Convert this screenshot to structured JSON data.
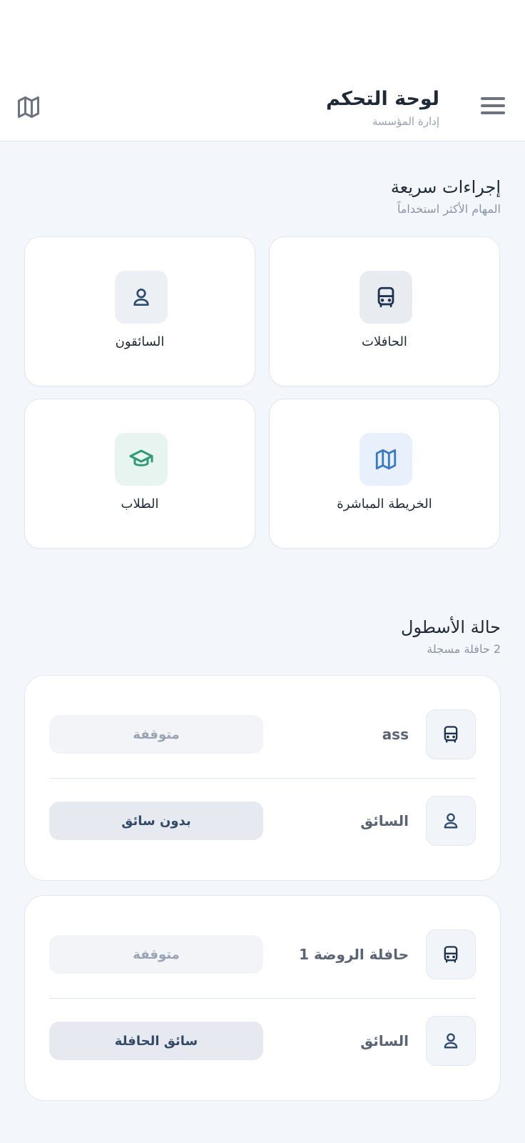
{
  "header": {
    "title": "لوحة التحكم",
    "subtitle": "إدارة المؤسسة",
    "menu_icon": "hamburger-menu-icon",
    "map_icon": "map-icon"
  },
  "quick_actions": {
    "title": "إجراءات سريعة",
    "subtitle": "المهام الأكثر استخداماً",
    "items": [
      {
        "label": "الحافلات",
        "icon": "bus-icon",
        "color": "#1f3350",
        "bg": "#e8ebef"
      },
      {
        "label": "السائقون",
        "icon": "user-icon",
        "color": "#2c4a72",
        "bg": "#eceff4"
      },
      {
        "label": "الخريطة المباشرة",
        "icon": "map-icon",
        "color": "#3a78c8",
        "bg": "#e8f0fb"
      },
      {
        "label": "الطلاب",
        "icon": "graduation-cap-icon",
        "color": "#2f9a73",
        "bg": "#e7f4ef"
      }
    ]
  },
  "fleet": {
    "title": "حالة الأسطول",
    "subtitle": "2 حافلة مسجلة",
    "buses": [
      {
        "name": "ass",
        "status": "متوقفة",
        "driver_label": "السائق",
        "driver": "بدون سائق"
      },
      {
        "name": "حافلة الروضة 1",
        "status": "متوقفة",
        "driver_label": "السائق",
        "driver": "سائق الحافلة"
      }
    ]
  }
}
